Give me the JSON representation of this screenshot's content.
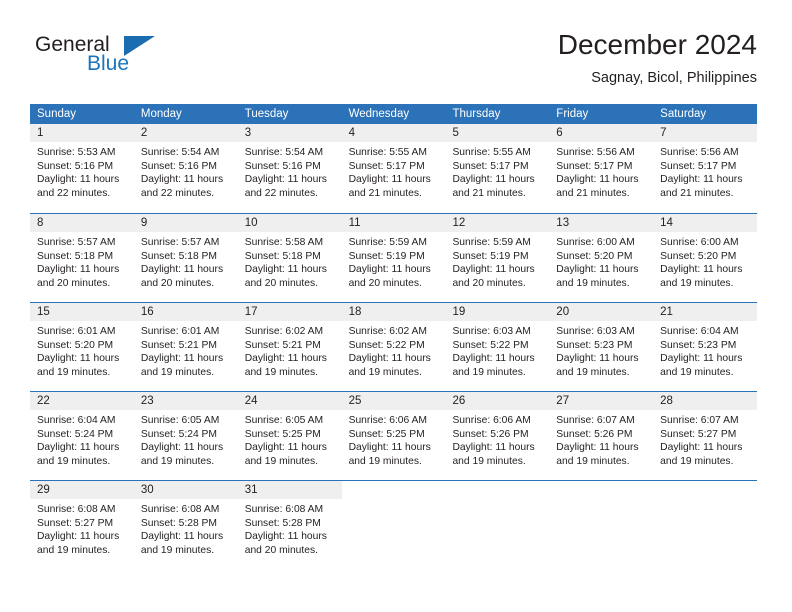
{
  "brand": {
    "name_part1": "General",
    "name_part2": "Blue",
    "triangle_color": "#1b6cb0",
    "blue_color": "#1b75bc"
  },
  "header": {
    "title": "December 2024",
    "subtitle": "Sagnay, Bicol, Philippines"
  },
  "theme": {
    "header_blue": "#2b72b8",
    "day_band_gray": "#efefef",
    "text_color": "#231f20"
  },
  "weekdays": [
    "Sunday",
    "Monday",
    "Tuesday",
    "Wednesday",
    "Thursday",
    "Friday",
    "Saturday"
  ],
  "weeks": [
    [
      {
        "day": "1",
        "sunrise": "Sunrise: 5:53 AM",
        "sunset": "Sunset: 5:16 PM",
        "daylight1": "Daylight: 11 hours",
        "daylight2": "and 22 minutes."
      },
      {
        "day": "2",
        "sunrise": "Sunrise: 5:54 AM",
        "sunset": "Sunset: 5:16 PM",
        "daylight1": "Daylight: 11 hours",
        "daylight2": "and 22 minutes."
      },
      {
        "day": "3",
        "sunrise": "Sunrise: 5:54 AM",
        "sunset": "Sunset: 5:16 PM",
        "daylight1": "Daylight: 11 hours",
        "daylight2": "and 22 minutes."
      },
      {
        "day": "4",
        "sunrise": "Sunrise: 5:55 AM",
        "sunset": "Sunset: 5:17 PM",
        "daylight1": "Daylight: 11 hours",
        "daylight2": "and 21 minutes."
      },
      {
        "day": "5",
        "sunrise": "Sunrise: 5:55 AM",
        "sunset": "Sunset: 5:17 PM",
        "daylight1": "Daylight: 11 hours",
        "daylight2": "and 21 minutes."
      },
      {
        "day": "6",
        "sunrise": "Sunrise: 5:56 AM",
        "sunset": "Sunset: 5:17 PM",
        "daylight1": "Daylight: 11 hours",
        "daylight2": "and 21 minutes."
      },
      {
        "day": "7",
        "sunrise": "Sunrise: 5:56 AM",
        "sunset": "Sunset: 5:17 PM",
        "daylight1": "Daylight: 11 hours",
        "daylight2": "and 21 minutes."
      }
    ],
    [
      {
        "day": "8",
        "sunrise": "Sunrise: 5:57 AM",
        "sunset": "Sunset: 5:18 PM",
        "daylight1": "Daylight: 11 hours",
        "daylight2": "and 20 minutes."
      },
      {
        "day": "9",
        "sunrise": "Sunrise: 5:57 AM",
        "sunset": "Sunset: 5:18 PM",
        "daylight1": "Daylight: 11 hours",
        "daylight2": "and 20 minutes."
      },
      {
        "day": "10",
        "sunrise": "Sunrise: 5:58 AM",
        "sunset": "Sunset: 5:18 PM",
        "daylight1": "Daylight: 11 hours",
        "daylight2": "and 20 minutes."
      },
      {
        "day": "11",
        "sunrise": "Sunrise: 5:59 AM",
        "sunset": "Sunset: 5:19 PM",
        "daylight1": "Daylight: 11 hours",
        "daylight2": "and 20 minutes."
      },
      {
        "day": "12",
        "sunrise": "Sunrise: 5:59 AM",
        "sunset": "Sunset: 5:19 PM",
        "daylight1": "Daylight: 11 hours",
        "daylight2": "and 20 minutes."
      },
      {
        "day": "13",
        "sunrise": "Sunrise: 6:00 AM",
        "sunset": "Sunset: 5:20 PM",
        "daylight1": "Daylight: 11 hours",
        "daylight2": "and 19 minutes."
      },
      {
        "day": "14",
        "sunrise": "Sunrise: 6:00 AM",
        "sunset": "Sunset: 5:20 PM",
        "daylight1": "Daylight: 11 hours",
        "daylight2": "and 19 minutes."
      }
    ],
    [
      {
        "day": "15",
        "sunrise": "Sunrise: 6:01 AM",
        "sunset": "Sunset: 5:20 PM",
        "daylight1": "Daylight: 11 hours",
        "daylight2": "and 19 minutes."
      },
      {
        "day": "16",
        "sunrise": "Sunrise: 6:01 AM",
        "sunset": "Sunset: 5:21 PM",
        "daylight1": "Daylight: 11 hours",
        "daylight2": "and 19 minutes."
      },
      {
        "day": "17",
        "sunrise": "Sunrise: 6:02 AM",
        "sunset": "Sunset: 5:21 PM",
        "daylight1": "Daylight: 11 hours",
        "daylight2": "and 19 minutes."
      },
      {
        "day": "18",
        "sunrise": "Sunrise: 6:02 AM",
        "sunset": "Sunset: 5:22 PM",
        "daylight1": "Daylight: 11 hours",
        "daylight2": "and 19 minutes."
      },
      {
        "day": "19",
        "sunrise": "Sunrise: 6:03 AM",
        "sunset": "Sunset: 5:22 PM",
        "daylight1": "Daylight: 11 hours",
        "daylight2": "and 19 minutes."
      },
      {
        "day": "20",
        "sunrise": "Sunrise: 6:03 AM",
        "sunset": "Sunset: 5:23 PM",
        "daylight1": "Daylight: 11 hours",
        "daylight2": "and 19 minutes."
      },
      {
        "day": "21",
        "sunrise": "Sunrise: 6:04 AM",
        "sunset": "Sunset: 5:23 PM",
        "daylight1": "Daylight: 11 hours",
        "daylight2": "and 19 minutes."
      }
    ],
    [
      {
        "day": "22",
        "sunrise": "Sunrise: 6:04 AM",
        "sunset": "Sunset: 5:24 PM",
        "daylight1": "Daylight: 11 hours",
        "daylight2": "and 19 minutes."
      },
      {
        "day": "23",
        "sunrise": "Sunrise: 6:05 AM",
        "sunset": "Sunset: 5:24 PM",
        "daylight1": "Daylight: 11 hours",
        "daylight2": "and 19 minutes."
      },
      {
        "day": "24",
        "sunrise": "Sunrise: 6:05 AM",
        "sunset": "Sunset: 5:25 PM",
        "daylight1": "Daylight: 11 hours",
        "daylight2": "and 19 minutes."
      },
      {
        "day": "25",
        "sunrise": "Sunrise: 6:06 AM",
        "sunset": "Sunset: 5:25 PM",
        "daylight1": "Daylight: 11 hours",
        "daylight2": "and 19 minutes."
      },
      {
        "day": "26",
        "sunrise": "Sunrise: 6:06 AM",
        "sunset": "Sunset: 5:26 PM",
        "daylight1": "Daylight: 11 hours",
        "daylight2": "and 19 minutes."
      },
      {
        "day": "27",
        "sunrise": "Sunrise: 6:07 AM",
        "sunset": "Sunset: 5:26 PM",
        "daylight1": "Daylight: 11 hours",
        "daylight2": "and 19 minutes."
      },
      {
        "day": "28",
        "sunrise": "Sunrise: 6:07 AM",
        "sunset": "Sunset: 5:27 PM",
        "daylight1": "Daylight: 11 hours",
        "daylight2": "and 19 minutes."
      }
    ],
    [
      {
        "day": "29",
        "sunrise": "Sunrise: 6:08 AM",
        "sunset": "Sunset: 5:27 PM",
        "daylight1": "Daylight: 11 hours",
        "daylight2": "and 19 minutes."
      },
      {
        "day": "30",
        "sunrise": "Sunrise: 6:08 AM",
        "sunset": "Sunset: 5:28 PM",
        "daylight1": "Daylight: 11 hours",
        "daylight2": "and 19 minutes."
      },
      {
        "day": "31",
        "sunrise": "Sunrise: 6:08 AM",
        "sunset": "Sunset: 5:28 PM",
        "daylight1": "Daylight: 11 hours",
        "daylight2": "and 20 minutes."
      },
      {
        "day": "",
        "sunrise": "",
        "sunset": "",
        "daylight1": "",
        "daylight2": ""
      },
      {
        "day": "",
        "sunrise": "",
        "sunset": "",
        "daylight1": "",
        "daylight2": ""
      },
      {
        "day": "",
        "sunrise": "",
        "sunset": "",
        "daylight1": "",
        "daylight2": ""
      },
      {
        "day": "",
        "sunrise": "",
        "sunset": "",
        "daylight1": "",
        "daylight2": ""
      }
    ]
  ]
}
